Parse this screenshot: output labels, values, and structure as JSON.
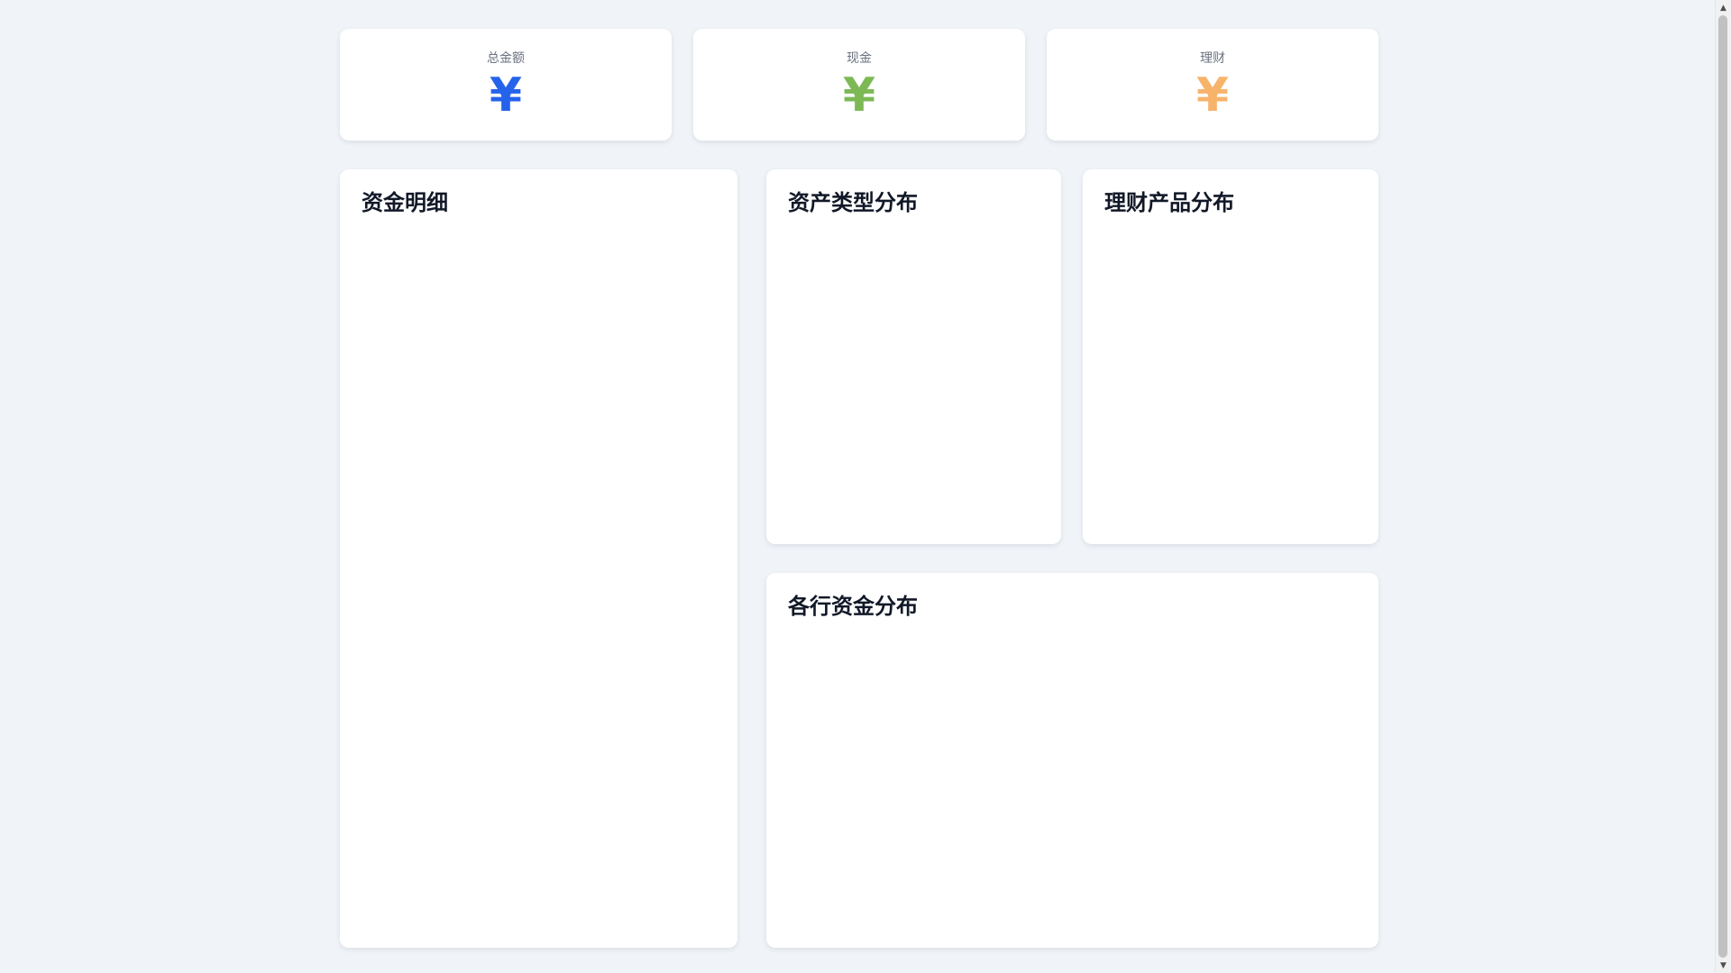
{
  "stats": [
    {
      "label": "总金额",
      "value": "¥",
      "color": "#2563eb"
    },
    {
      "label": "现金",
      "value": "¥",
      "color": "#7cb955"
    },
    {
      "label": "理财",
      "value": "¥",
      "color": "#f8b36b"
    }
  ],
  "panels": {
    "fund_details": {
      "title": "资金明细"
    },
    "asset_type": {
      "title": "资产类型分布"
    },
    "wealth_product": {
      "title": "理财产品分布"
    },
    "bank_funds": {
      "title": "各行资金分布"
    }
  },
  "scrollbar": {
    "up_icon": "arrow-up-icon",
    "down_icon": "arrow-down-icon"
  }
}
